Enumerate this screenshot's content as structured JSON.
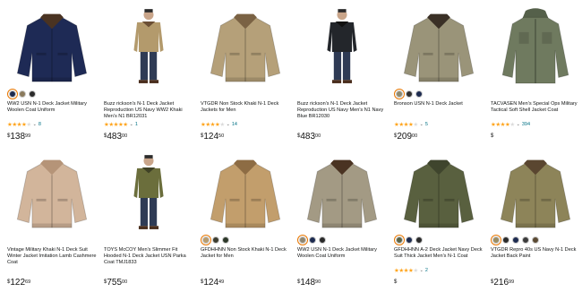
{
  "products": [
    {
      "title": "WW2 USN N-1 Deck Jacket Military Woolen Coat Uniform",
      "rating": 4,
      "rating_count": "8",
      "price_symbol": "$",
      "price_whole": "138",
      "price_fraction": "99",
      "swatches": [
        "#1d2b50",
        "#8a7a5c",
        "#2a2a2a"
      ],
      "product_color": "#1e2a55",
      "trim_color": "#4a3322",
      "image_type": "jacket"
    },
    {
      "title": "Buzz rickson's N-1 Deck Jacket Reproduction US Navy WW2 Khaki Men's N1 BR12031",
      "rating": 5,
      "rating_count": "1",
      "price_symbol": "$",
      "price_whole": "483",
      "price_fraction": "00",
      "swatches": [],
      "product_color": "#b39a6c",
      "trim_color": "#6b4f35",
      "image_type": "person"
    },
    {
      "title": "VTGDR Non Stock Khaki N-1 Deck Jackets for Men",
      "rating": 4,
      "rating_count": "14",
      "price_symbol": "$",
      "price_whole": "124",
      "price_fraction": "50",
      "swatches": [],
      "product_color": "#b5a079",
      "trim_color": "#7a6244",
      "image_type": "jacket"
    },
    {
      "title": "Buzz rickson's N-1 Deck Jacket Reproduction US Navy Men's N1 Navy Blue BR12030",
      "rating": 0,
      "rating_count": "",
      "price_symbol": "$",
      "price_whole": "483",
      "price_fraction": "00",
      "swatches": [],
      "product_color": "#23262b",
      "trim_color": "#111111",
      "image_type": "person"
    },
    {
      "title": "Bronson USN N-1 Deck Jacket",
      "rating": 4,
      "rating_count": "5",
      "price_symbol": "$",
      "price_whole": "209",
      "price_fraction": "00",
      "swatches": [
        "#8f8a6e",
        "#2f2f2f",
        "#1d2b50"
      ],
      "product_color": "#9a9479",
      "trim_color": "#3a3026",
      "image_type": "jacket"
    },
    {
      "title": "TACVASEN Men's Special Ops Military Tactical Soft Shell Jacket Coat",
      "rating": 4,
      "rating_count": "394",
      "price_symbol": "$",
      "price_whole": "",
      "price_fraction": "",
      "swatches": [],
      "product_color": "#6f7a5f",
      "trim_color": "#55604a",
      "image_type": "softshell"
    },
    {
      "title": "Vintage Military Khaki N-1 Deck Suit Winter Jacket Imitation Lamb Cashmere Coat",
      "rating": 0,
      "rating_count": "",
      "price_symbol": "$",
      "price_whole": "122",
      "price_fraction": "69",
      "swatches": [],
      "product_color": "#d2b59b",
      "trim_color": "#b59478",
      "image_type": "jacket"
    },
    {
      "title": "TOYS McCOY Men's Slimmer Fit Hooded N-1 Deck Jacket USN Parka Coat TMJ1833",
      "rating": 0,
      "rating_count": "",
      "price_symbol": "$",
      "price_whole": "755",
      "price_fraction": "00",
      "swatches": [],
      "product_color": "#6b6e3c",
      "trim_color": "#3f4126",
      "image_type": "person"
    },
    {
      "title": "GFDHHNN Non Stock Khaki N-1 Deck Jacket for Men",
      "rating": 0,
      "rating_count": "",
      "price_symbol": "$",
      "price_whole": "124",
      "price_fraction": "49",
      "swatches": [
        "#b79c6e",
        "#3d3d2f",
        "#2c3828"
      ],
      "product_color": "#c29e6c",
      "trim_color": "#8d6c44",
      "image_type": "jacket"
    },
    {
      "title": "WW2 USN N-1 Deck Jacket Military Woolen Coat Uniform",
      "rating": 0,
      "rating_count": "",
      "price_symbol": "$",
      "price_whole": "148",
      "price_fraction": "90",
      "swatches": [
        "#8f8670",
        "#1d2b50",
        "#2a2a2a"
      ],
      "product_color": "#a39a84",
      "trim_color": "#4a3322",
      "image_type": "jacket"
    },
    {
      "title": "GFDHHNN A-2 Deck Jacket Navy Deck Suit Thick Jacket Men's N-1 Coat",
      "rating": 4,
      "rating_count": "2",
      "price_symbol": "$",
      "price_whole": "",
      "price_fraction": "",
      "swatches": [
        "#5a6346",
        "#1d2b50",
        "#2a2a2a"
      ],
      "product_color": "#59603f",
      "trim_color": "#3f452d",
      "image_type": "jacket"
    },
    {
      "title": "VTGDR Repro 40s US Navy N-1 Deck Jacket Back Paint",
      "rating": 0,
      "rating_count": "",
      "price_symbol": "$",
      "price_whole": "216",
      "price_fraction": "99",
      "swatches": [
        "#9a8d63",
        "#2a2a2a",
        "#1d2b50",
        "#3b3b3b",
        "#5b4a33"
      ],
      "product_color": "#8d8459",
      "trim_color": "#5a4630",
      "image_type": "jacket"
    }
  ]
}
